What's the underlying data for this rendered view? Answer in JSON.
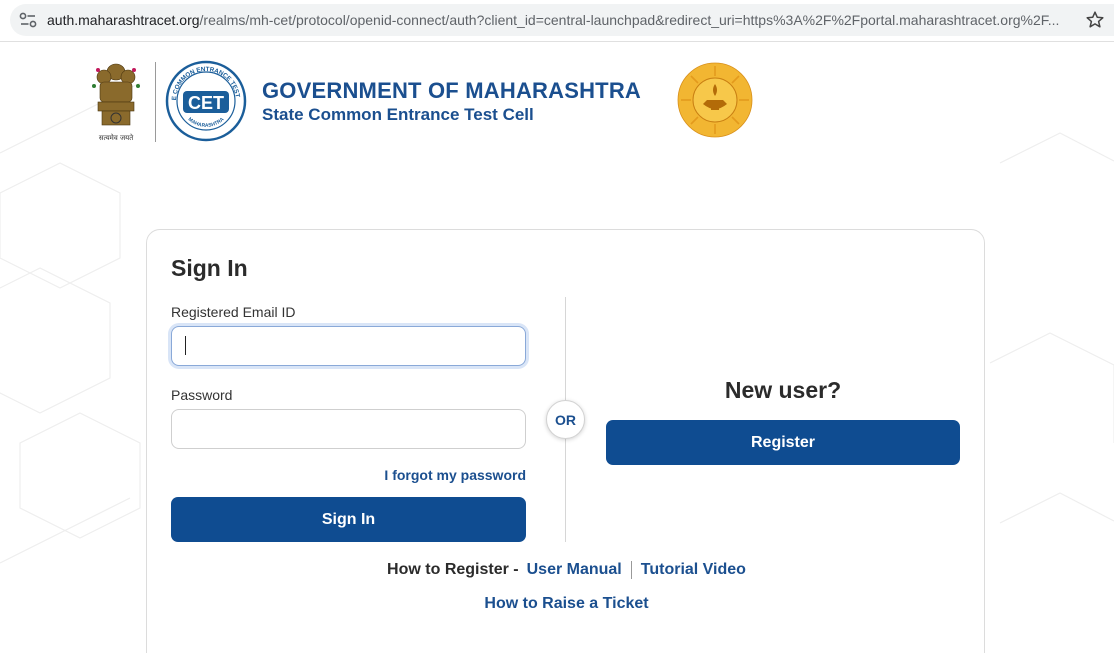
{
  "browser": {
    "url_host": "auth.maharashtracet.org",
    "url_rest": "/realms/mh-cet/protocol/openid-connect/auth?client_id=central-launchpad&redirect_uri=https%3A%2F%2Fportal.maharashtracet.org%2F..."
  },
  "header": {
    "emblem_motto": "सत्यमेव जयते",
    "cet_logo_text": "CET",
    "cet_logo_ring_text": "STATE COMMON ENTRANCE TEST CELL",
    "cet_logo_bottom_text": "MAHARASHTRA",
    "title": "GOVERNMENT OF MAHARASHTRA",
    "subtitle": "State Common Entrance Test Cell"
  },
  "signin": {
    "heading": "Sign In",
    "email_label": "Registered Email ID",
    "email_value": "",
    "password_label": "Password",
    "password_value": "",
    "forgot_link": "I forgot my password",
    "submit_label": "Sign In"
  },
  "divider": {
    "or_label": "OR"
  },
  "register": {
    "heading": "New user?",
    "button_label": "Register"
  },
  "help": {
    "how_to_register_label": "How to Register -",
    "user_manual_link": "User Manual",
    "tutorial_video_link": "Tutorial Video",
    "raise_ticket_link": "How to Raise a Ticket"
  },
  "colors": {
    "brand_blue": "#0f4c91",
    "link_blue": "#1b4f8f",
    "seal_gold": "#f2b632"
  },
  "icons": [
    "site-info-icon",
    "star-icon",
    "national-emblem-icon",
    "cet-logo-icon",
    "maharashtra-seal-icon"
  ]
}
